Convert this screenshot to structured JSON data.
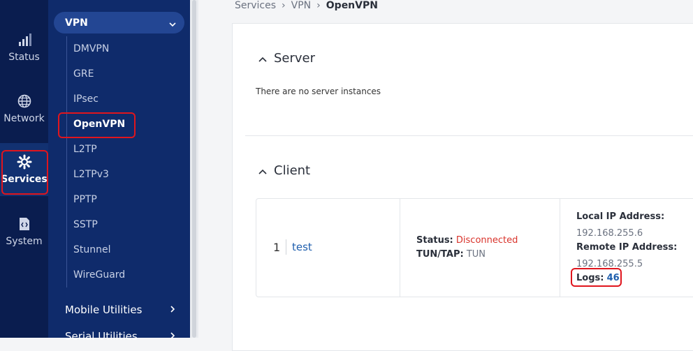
{
  "rail": [
    {
      "label": "Status",
      "icon": "signal-bars-icon"
    },
    {
      "label": "Network",
      "icon": "globe-icon"
    },
    {
      "label": "Services",
      "icon": "gear-icon",
      "active": true
    },
    {
      "label": "System",
      "icon": "system-chip-icon"
    }
  ],
  "submenu": {
    "section": "VPN",
    "items": [
      "DMVPN",
      "GRE",
      "IPsec",
      "OpenVPN",
      "L2TP",
      "L2TPv3",
      "PPTP",
      "SSTP",
      "Stunnel",
      "WireGuard"
    ],
    "active": "OpenVPN",
    "groups": [
      "Mobile Utilities",
      "Serial Utilities"
    ]
  },
  "breadcrumb": [
    "Services",
    "VPN",
    "OpenVPN"
  ],
  "server": {
    "title": "Server",
    "empty": "There are no server instances"
  },
  "client": {
    "title": "Client",
    "row": {
      "index": "1",
      "name": "test",
      "status_label": "Status:",
      "status_value": "Disconnected",
      "tuntap_label": "TUN/TAP:",
      "tuntap_value": "TUN",
      "local_ip_label": "Local IP Address:",
      "local_ip_value": "192.168.255.6",
      "remote_ip_label": "Remote IP Address:",
      "remote_ip_value": "192.168.255.5",
      "logs_label": "Logs:",
      "logs_value": "46"
    }
  },
  "colors": {
    "rail_bg": "#0a1d4f",
    "submenu_bg": "#0f2b6b",
    "accent": "#e0151d",
    "link": "#1f5fae"
  }
}
